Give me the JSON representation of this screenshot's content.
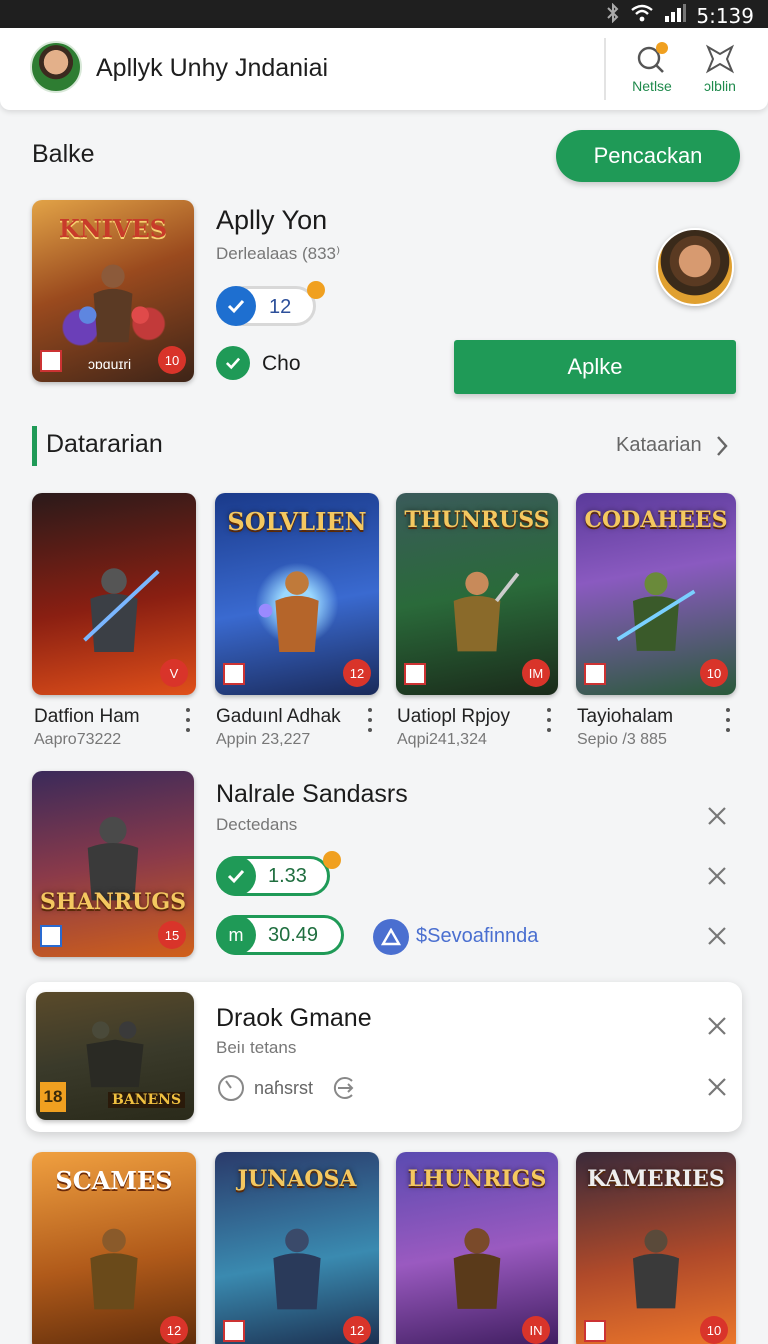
{
  "status_bar": {
    "time": "5:139"
  },
  "app_bar": {
    "title": "Apllyk Unhy Jndaniai",
    "actions": [
      {
        "label": "Netlse",
        "icon": "search-icon"
      },
      {
        "label": "ɔlblin",
        "icon": "star-outline-icon"
      }
    ]
  },
  "featured": {
    "section_title": "Balke",
    "header_button": "Pencackan",
    "cover_text": "ɔɒɑuɪri",
    "cover_badge": "10",
    "name": "Aplly Yon",
    "subtitle": "Derlealaas (833⁾",
    "rating_value": "12",
    "check_label": "Cho",
    "install_button": "Aplke"
  },
  "section2": {
    "title": "Datararian",
    "see_all": "Kataarian"
  },
  "grid_row1": [
    {
      "title": "Datfion Ham",
      "sub": "Aapro73222",
      "badge": "V",
      "logo": ""
    },
    {
      "title": "Gaduınl Adhak",
      "sub": "Appin 23,227",
      "badge": "12",
      "logo": "SOLVLIEN"
    },
    {
      "title": "Uatiopl Rpjoy",
      "sub": "Aqpi241,324",
      "badge": "IM",
      "logo": "THUNRUSS"
    },
    {
      "title": "Tayiohalam",
      "sub": "Sepio /3 885",
      "badge": "10",
      "logo": "CODAHEES"
    }
  ],
  "list_item": {
    "name": "Nalrale Sandasrs",
    "sub": "Dectedans",
    "logo": "SHANRUGS",
    "badge": "15",
    "value1": "1.33",
    "value2_prefix": "m",
    "value2": "30.49",
    "link": "Sevoafinnda"
  },
  "card_item": {
    "name": "Draok Gmane",
    "sub": "Beiı tetans",
    "logo": "BANENS",
    "badge": "18",
    "timer_label": "naɦsrst"
  },
  "grid_row2": [
    {
      "logo": "SCAMES",
      "badge": "12"
    },
    {
      "logo": "JUNAOSA",
      "badge": "12"
    },
    {
      "logo": "LHUNRIGS",
      "badge": "IN"
    },
    {
      "logo": "KAMERIES",
      "badge": "10"
    }
  ],
  "colors": {
    "accent": "#1f9a57",
    "badge": "#d9342a",
    "link": "#4a6fd0"
  }
}
